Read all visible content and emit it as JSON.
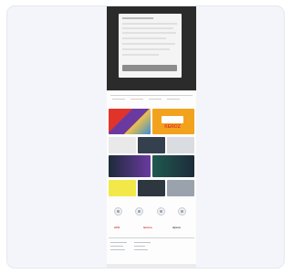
{
  "modal": {
    "accept_label": "",
    "text_lines": [
      "",
      "",
      "",
      "",
      "",
      "",
      ""
    ]
  },
  "promo": {
    "badge": "KEROZ"
  },
  "brands": [
    "ACE",
    "lenovo",
    "dyson"
  ],
  "colors": {
    "page_bg": "#f3f5fa",
    "overlay": "#2b2b2b",
    "promo_orange": "#f3a21e",
    "promo_red": "#e0342b",
    "promo_purple": "#6b3aa0",
    "dark_tile": "#1d2b3a",
    "yellow_banner": "#f2e84a",
    "brand_red": "#d0282d"
  },
  "icons": [
    "category-icon-1",
    "category-icon-2",
    "category-icon-3",
    "category-icon-4"
  ]
}
